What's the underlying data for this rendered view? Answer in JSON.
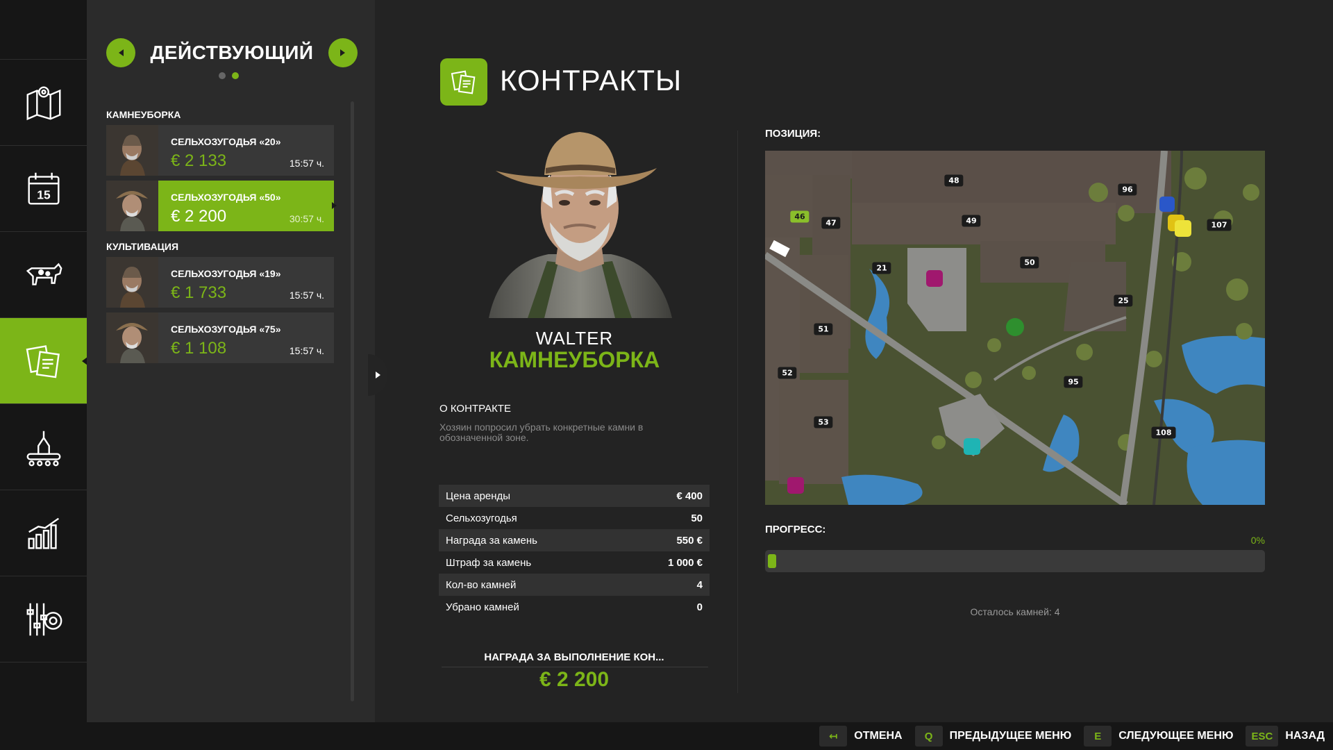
{
  "list": {
    "title": "ДЕЙСТВУЮЩИЙ",
    "groups": [
      {
        "label": "КАМНЕУБОРКА"
      },
      {
        "label": "КУЛЬТИВАЦИЯ"
      }
    ],
    "rows": [
      {
        "field": "СЕЛЬХОЗУГОДЬЯ «20»",
        "price": "€ 2 133",
        "time": "15:57 ч."
      },
      {
        "field": "СЕЛЬХОЗУГОДЬЯ «50»",
        "price": "€ 2 200",
        "time": "30:57 ч."
      },
      {
        "field": "СЕЛЬХОЗУГОДЬЯ «19»",
        "price": "€ 1 733",
        "time": "15:57 ч."
      },
      {
        "field": "СЕЛЬХОЗУГОДЬЯ «75»",
        "price": "€ 1 108",
        "time": "15:57 ч."
      }
    ]
  },
  "page": {
    "title": "КОНТРАКТЫ"
  },
  "npc": {
    "name": "WALTER",
    "type": "КАМНЕУБОРКА"
  },
  "about": {
    "heading": "О КОНТРАКТЕ",
    "text": "Хозяин попросил убрать конкретные камни в обозначенной зоне."
  },
  "details": [
    {
      "label": "Цена аренды",
      "value": "€ 400"
    },
    {
      "label": "Сельхозугодья",
      "value": "50"
    },
    {
      "label": "Награда за камень",
      "value": "550 €"
    },
    {
      "label": "Штраф за камень",
      "value": "1 000 €"
    },
    {
      "label": "Кол-во камней",
      "value": "4"
    },
    {
      "label": "Убрано камней",
      "value": "0"
    }
  ],
  "reward": {
    "heading": "НАГРАДА ЗА ВЫПОЛНЕНИЕ КОН...",
    "value": "€ 2 200"
  },
  "position": {
    "heading": "ПОЗИЦИЯ:",
    "field_labels": [
      "48",
      "96",
      "47",
      "46",
      "49",
      "107",
      "21",
      "50",
      "25",
      "51",
      "52",
      "95",
      "53",
      "108"
    ]
  },
  "progress": {
    "heading": "ПРОГРЕСС:",
    "percent_text": "0%",
    "fraction": 0.0,
    "remaining": "Осталось камней: 4"
  },
  "footer": [
    {
      "key": "↤",
      "label": "ОТМЕНА"
    },
    {
      "key": "Q",
      "label": "ПРЕДЫДУЩЕЕ МЕНЮ"
    },
    {
      "key": "E",
      "label": "СЛЕДУЮЩЕЕ МЕНЮ"
    },
    {
      "key": "ESC",
      "label": "НАЗАД"
    }
  ],
  "nav_icons": [
    "map-icon",
    "calendar-icon",
    "animals-icon",
    "contracts-icon",
    "production-icon",
    "statistics-icon",
    "settings-icon"
  ],
  "colors": {
    "accent": "#7cb518",
    "background": "#232323",
    "sidebar": "#161616"
  }
}
